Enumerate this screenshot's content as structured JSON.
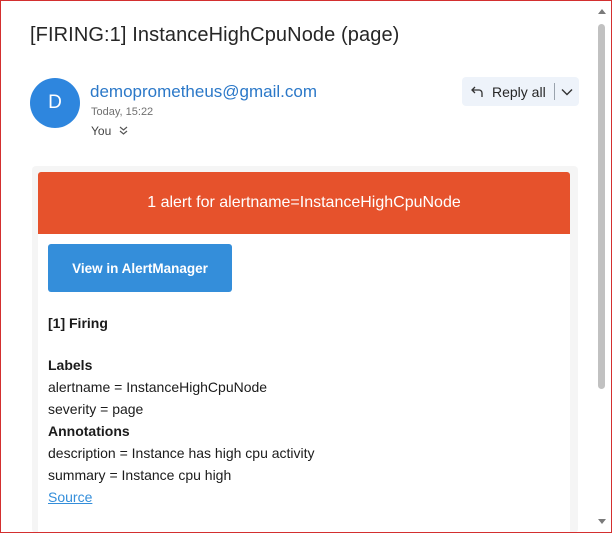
{
  "email": {
    "subject": "[FIRING:1] InstanceHighCpuNode (page)",
    "avatar_letter": "D",
    "sender": "demoprometheus@gmail.com",
    "time": "Today, 15:22",
    "to": "You",
    "reply_all_label": "Reply all"
  },
  "alert": {
    "banner": "1 alert for alertname=InstanceHighCpuNode",
    "button_label": "View in AlertManager",
    "firing": "[1] Firing",
    "labels_heading": "Labels",
    "labels": [
      "alertname = InstanceHighCpuNode",
      "severity = page"
    ],
    "annotations_heading": "Annotations",
    "annotations": [
      "description = Instance has high cpu activity",
      "summary = Instance cpu high"
    ],
    "source_link": "Source"
  },
  "colors": {
    "banner": "#e6522c",
    "button": "#348eda",
    "avatar": "#2e86de",
    "sender_link": "#2b78c8"
  }
}
